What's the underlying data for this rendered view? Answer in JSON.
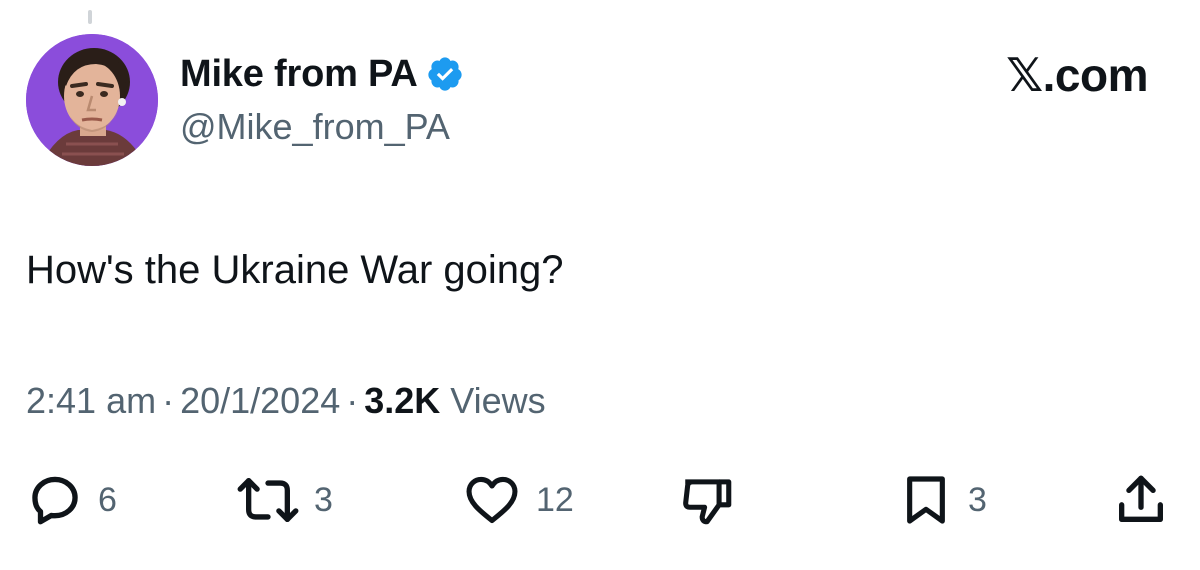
{
  "author": {
    "display_name": "Mike from PA",
    "handle": "@Mike_from_PA",
    "verified_icon": "verified-badge-icon",
    "avatar_bg": "#8b4ddb"
  },
  "brand": {
    "logo_text": "𝕏.com"
  },
  "tweet": {
    "text": "How's the Ukraine War going?"
  },
  "meta": {
    "time": "2:41 am",
    "separator": "·",
    "date": "20/1/2024",
    "views_count": "3.2K",
    "views_label": "Views"
  },
  "actions": {
    "reply": {
      "icon": "reply-icon",
      "count": "6"
    },
    "retweet": {
      "icon": "retweet-icon",
      "count": "3"
    },
    "like": {
      "icon": "heart-icon",
      "count": "12"
    },
    "dislike": {
      "icon": "thumbs-down-icon"
    },
    "bookmark": {
      "icon": "bookmark-icon",
      "count": "3"
    },
    "share": {
      "icon": "share-icon"
    }
  },
  "colors": {
    "text_primary": "#0f1419",
    "text_secondary": "#536471",
    "verified_blue": "#1d9bf0"
  }
}
